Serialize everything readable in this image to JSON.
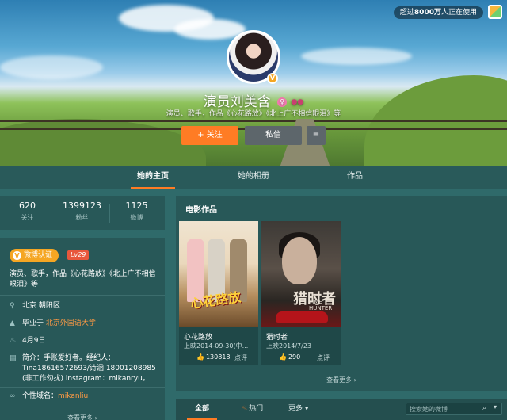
{
  "cover": {
    "users_badge_prefix": "超过",
    "users_badge_count": "8000万",
    "users_badge_suffix": "人正在使用"
  },
  "profile": {
    "name": "演员刘美含",
    "gender_symbol": "♀",
    "bio": "演员、歌手，作品《心花路放》《北上广不相信眼泪》等",
    "follow_label": "+ 关注",
    "message_label": "私信",
    "more_label": "≡"
  },
  "tabs": [
    {
      "label": "她的主页"
    },
    {
      "label": "她的相册"
    },
    {
      "label": "作品"
    }
  ],
  "stats": [
    {
      "value": "620",
      "label": "关注"
    },
    {
      "value": "1399123",
      "label": "粉丝"
    },
    {
      "value": "1125",
      "label": "微博"
    }
  ],
  "info": {
    "verify_label": "微博认证",
    "level": "Lv29",
    "intro": "演员、歌手，作品《心花路放》《北上广不相信眼泪》等",
    "location": "北京 朝阳区",
    "education_prefix": "毕业于",
    "education": "北京外国语大学",
    "birthday": "4月9日",
    "profile_text": "简介：手账爱好者。经纪人：Tina18616572693/诗涵 18001208985 (非工作勿扰) instagram：mikanryu。",
    "domain_prefix": "个性域名：",
    "domain": "mikanliu",
    "see_more": "查看更多 ›"
  },
  "movies": {
    "heading": "电影作品",
    "items": [
      {
        "title": "心花路放",
        "date": "上映2014-09-30(中...",
        "likes": "130818",
        "comment": "点评",
        "poster_title": "心花路放"
      },
      {
        "title": "猎时者",
        "date": "上映2014/7/23",
        "likes": "290",
        "comment": "点评",
        "poster_title": "猎时者",
        "poster_sub": "TIME HUNTER"
      }
    ],
    "see_more": "查看更多 ›"
  },
  "feed": {
    "tab_all": "全部",
    "tab_hot": "热门",
    "tab_more": "更多",
    "search_placeholder": "搜索她的微博"
  }
}
